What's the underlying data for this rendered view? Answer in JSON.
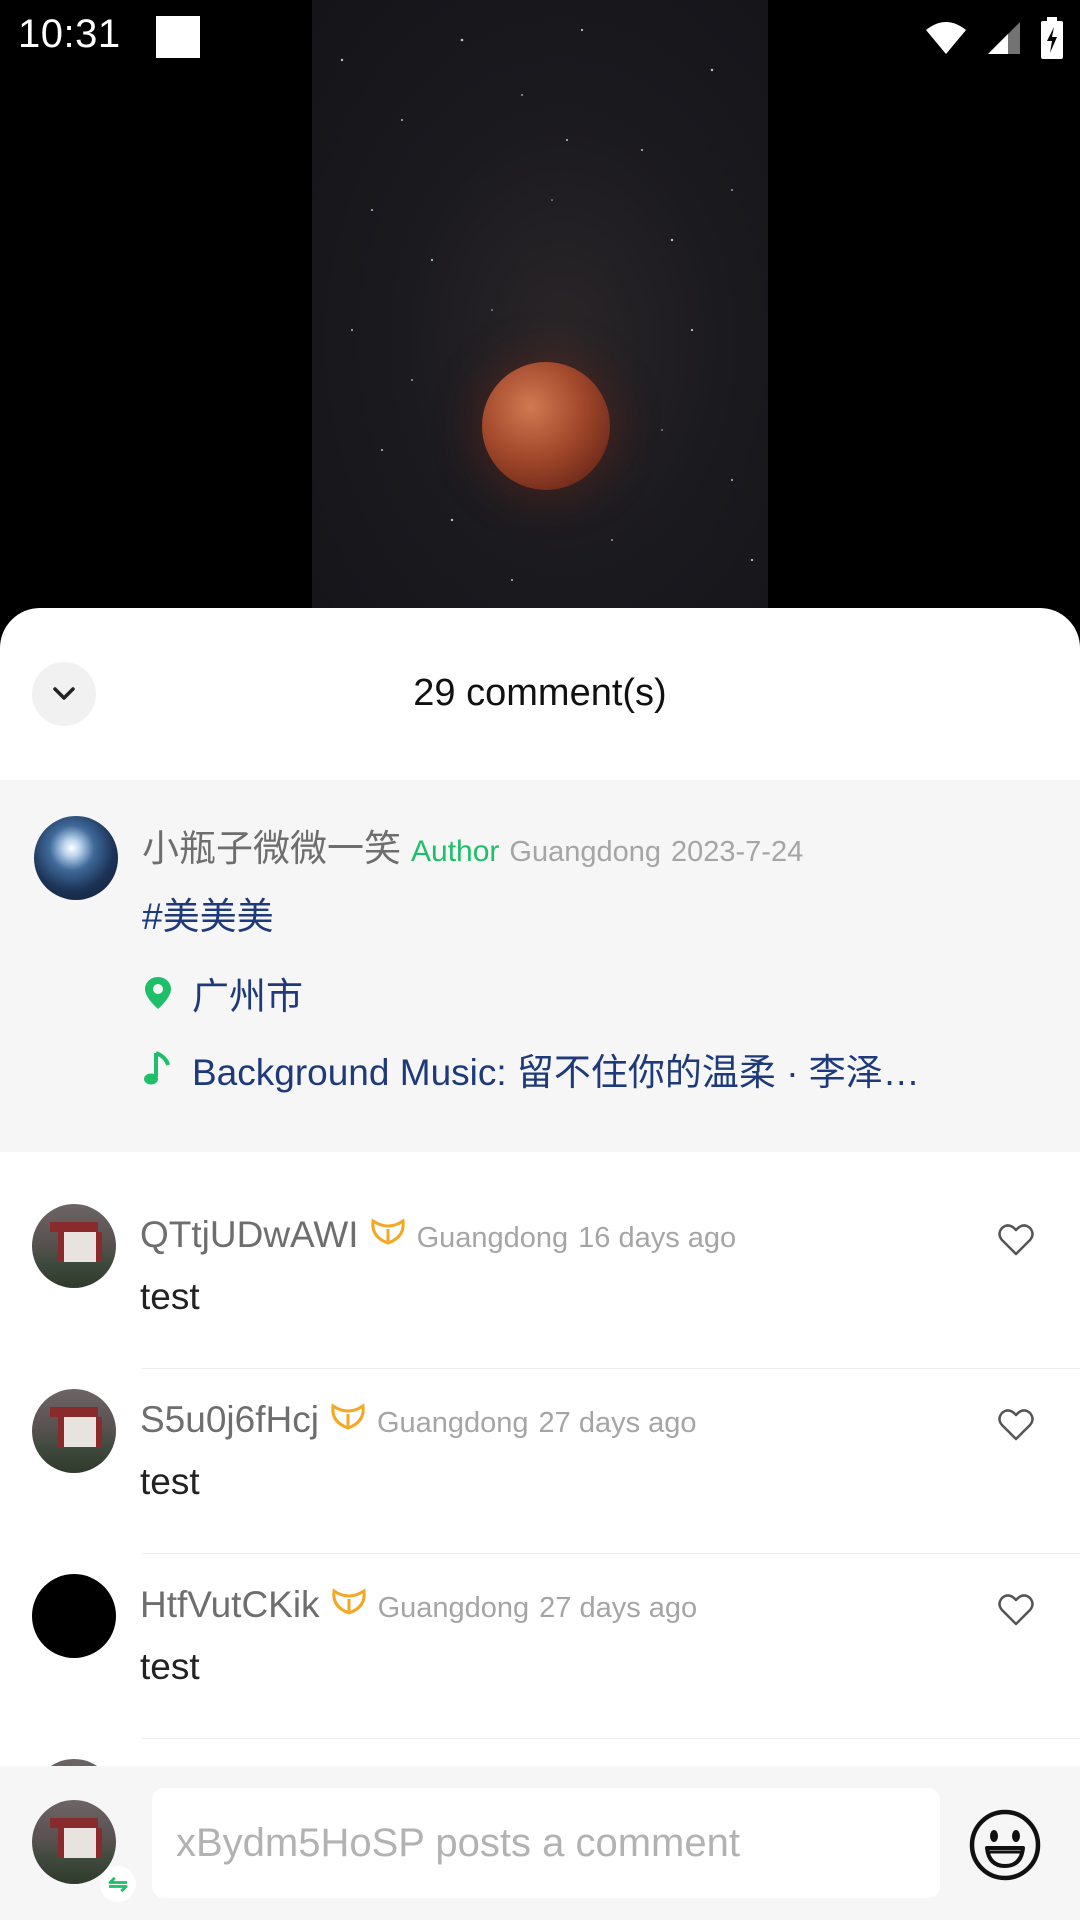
{
  "status_bar": {
    "time": "10:31"
  },
  "sheet": {
    "title": "29 comment(s)"
  },
  "post": {
    "username": "小瓶子微微一笑",
    "author_tag": "Author",
    "region": "Guangdong",
    "date": "2023-7-24",
    "hashtag": "#美美美",
    "location": "广州市",
    "music_label": "Background Music: 留不住你的温柔 · 李泽…"
  },
  "comments": [
    {
      "username": "QTtjUDwAWI",
      "region": "Guangdong",
      "time": "16 days ago",
      "text": "test"
    },
    {
      "username": "S5u0j6fHcj",
      "region": "Guangdong",
      "time": "27 days ago",
      "text": "test"
    },
    {
      "username": "HtfVutCKik",
      "region": "Guangdong",
      "time": "27 days ago",
      "text": "test"
    }
  ],
  "composer": {
    "placeholder": "xBydm5HoSP posts a comment"
  },
  "colors": {
    "accent": "#1fbf6a",
    "link": "#1f3a7a",
    "badge": "#f5a623"
  }
}
